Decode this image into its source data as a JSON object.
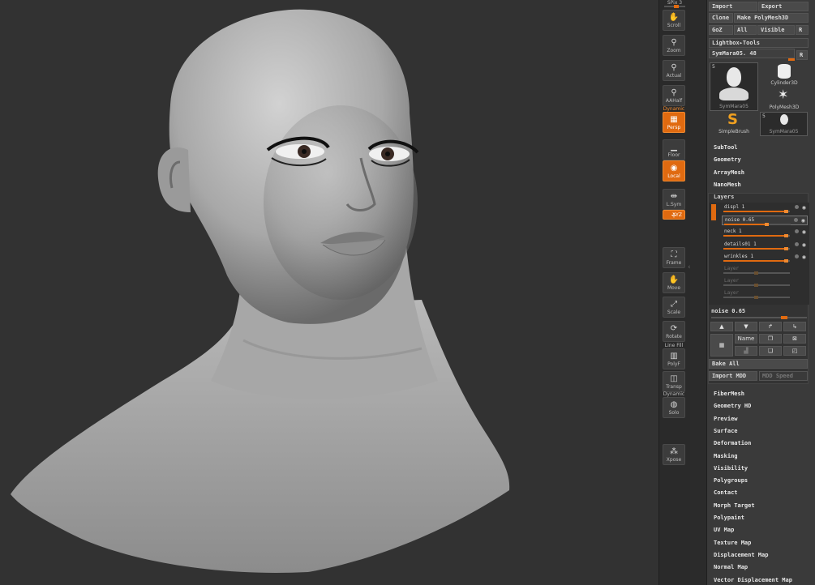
{
  "shelf": {
    "top_label": "SPix 3",
    "buttons": [
      {
        "id": "scroll",
        "label": "Scroll",
        "icon": "hand-icon",
        "glyph": "✋",
        "on": false
      },
      {
        "id": "zoom",
        "label": "Zoom",
        "icon": "magnifier-icon",
        "glyph": "⚲",
        "on": false
      },
      {
        "id": "actual",
        "label": "Actual",
        "icon": "magnifier-icon",
        "glyph": "⚲",
        "on": false
      },
      {
        "id": "aahalf",
        "label": "AAHalf",
        "icon": "magnifier-icon",
        "glyph": "⚲",
        "on": false
      },
      {
        "id": "persp",
        "label": "Persp",
        "icon": "perspective-icon",
        "glyph": "▦",
        "on": true,
        "top_text": "Dynamic"
      },
      {
        "id": "floor",
        "label": "Floor",
        "icon": "floor-grid-icon",
        "glyph": "▁",
        "on": false
      },
      {
        "id": "local",
        "label": "Local",
        "icon": "local-icon",
        "glyph": "◉",
        "on": true
      },
      {
        "id": "lsym",
        "label": "L.Sym",
        "icon": "symmetry-icon",
        "glyph": "⇹",
        "on": false
      },
      {
        "id": "xyz",
        "label": "XYZ",
        "icon": "xyz-axis-icon",
        "glyph": "⊹",
        "on": true
      },
      {
        "id": "frame",
        "label": "Frame",
        "icon": "frame-icon",
        "glyph": "⛶",
        "on": false
      },
      {
        "id": "move",
        "label": "Move",
        "icon": "move-hand-icon",
        "glyph": "✋",
        "on": false
      },
      {
        "id": "scale",
        "label": "Scale",
        "icon": "scale-icon",
        "glyph": "⤢",
        "on": false
      },
      {
        "id": "rotate",
        "label": "Rotate",
        "icon": "rotate-icon",
        "glyph": "⟳",
        "on": false
      },
      {
        "id": "polyf",
        "label": "PolyF",
        "icon": "polyframe-icon",
        "glyph": "▥",
        "on": false,
        "top_text": "Line Fill"
      },
      {
        "id": "transp",
        "label": "Transp",
        "icon": "transparency-icon",
        "glyph": "◫",
        "on": false
      },
      {
        "id": "solo",
        "label": "Solo",
        "icon": "solo-icon",
        "glyph": "◍",
        "on": false,
        "top_text": "Dynamic"
      },
      {
        "id": "xpose",
        "label": "Xpose",
        "icon": "xpose-icon",
        "glyph": "⁂",
        "on": false
      }
    ]
  },
  "tool": {
    "import": "Import",
    "export": "Export",
    "clone": "Clone",
    "make_polymesh": "Make PolyMesh3D",
    "goz": "GoZ",
    "all": "All",
    "visible": "Visible",
    "r": "R",
    "lightbox_tools": "Lightbox▸Tools",
    "current_tool": "SymMara05. 48",
    "thumbs": [
      {
        "label": "SymMara05",
        "icon": "head-bust-icon"
      },
      {
        "label": "Cylinder3D",
        "icon": "cylinder-icon"
      },
      {
        "label": "PolyMesh3D",
        "icon": "star-icon"
      },
      {
        "label": "SimpleBrush",
        "icon": "simplebrush-icon"
      },
      {
        "label": "SymMara05",
        "icon": "head-bust-icon"
      }
    ],
    "thumb_count_1": "5",
    "thumb_count_2": "5"
  },
  "menus_top": [
    "SubTool",
    "Geometry",
    "ArrayMesh",
    "NanoMesh"
  ],
  "layers": {
    "title": "Layers",
    "rows": [
      {
        "name": "displ 1",
        "value": 0.95,
        "active": true
      },
      {
        "name": "noise 0.65",
        "value": 0.65,
        "active": true,
        "selected": true
      },
      {
        "name": "neck 1",
        "value": 0.95,
        "active": true
      },
      {
        "name": "details01 1",
        "value": 0.95,
        "active": true
      },
      {
        "name": "wrinkles 1",
        "value": 0.95,
        "active": true
      },
      {
        "name": "Layer",
        "value": 0.5,
        "active": false
      },
      {
        "name": "Layer",
        "value": 0.5,
        "active": false
      },
      {
        "name": "Layer",
        "value": 0.5,
        "active": false
      }
    ],
    "slider_label": "noise 0.65",
    "name_btn": "Name",
    "bake_all": "Bake All",
    "import_mdd": "Import MDD",
    "mdd_speed": "MDD Speed"
  },
  "menus_bottom": [
    "FiberMesh",
    "Geometry HD",
    "Preview",
    "Surface",
    "Deformation",
    "Masking",
    "Visibility",
    "Polygroups",
    "Contact",
    "Morph Target",
    "Polypaint",
    "UV Map",
    "Texture Map",
    "Displacement Map",
    "Normal Map",
    "Vector Displacement Map"
  ],
  "colors": {
    "accent": "#e06a10",
    "bg": "#323232"
  }
}
